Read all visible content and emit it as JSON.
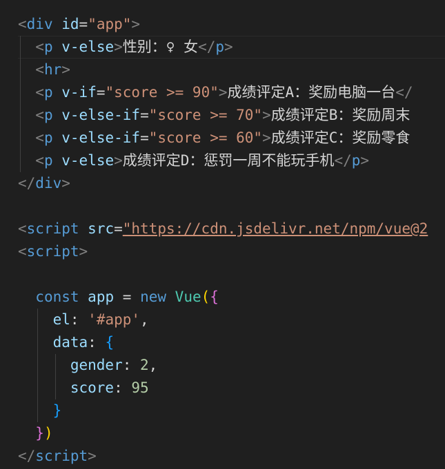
{
  "colors": {
    "background": "#1f1f1f",
    "tag_bracket": "#808080",
    "tag_name": "#569cd6",
    "attribute": "#9cdcfe",
    "string": "#ce9178",
    "text": "#d4d4d4",
    "keyword": "#569cd6",
    "class_name": "#4ec9b0",
    "number": "#b5cea8",
    "bracket_level1": "#ffd700",
    "bracket_level2": "#da70d6",
    "bracket_level3": "#179fff"
  },
  "code": {
    "div_open": {
      "tag": "div",
      "attr": "id",
      "value": "\"app\""
    },
    "p_gender": {
      "tag": "p",
      "attr": "v-else",
      "text": "性别：♀ 女"
    },
    "hr": {
      "tag": "hr"
    },
    "p_a": {
      "tag": "p",
      "attr": "v-if",
      "value": "\"score >= 90\"",
      "text": "成绩评定A：奖励电脑一台"
    },
    "p_b": {
      "tag": "p",
      "attr": "v-else-if",
      "value": "\"score >= 70\"",
      "text": "成绩评定B：奖励周末"
    },
    "p_c": {
      "tag": "p",
      "attr": "v-else-if",
      "value": "\"score >= 60\"",
      "text": "成绩评定C：奖励零食"
    },
    "p_d": {
      "tag": "p",
      "attr": "v-else",
      "text": "成绩评定D：惩罚一周不能玩手机"
    },
    "div_close": {
      "tag": "div"
    },
    "script_src": {
      "tag": "script",
      "attr": "src",
      "value": "\"https://cdn.jsdelivr.net/npm/vue@2"
    },
    "script_open": {
      "tag": "script"
    },
    "js_const": {
      "kw_const": "const",
      "var": "app",
      "op": "=",
      "kw_new": "new",
      "cls": "Vue"
    },
    "js_el": {
      "key": "el",
      "value": "'#app'"
    },
    "js_data": {
      "key": "data"
    },
    "js_gender": {
      "key": "gender",
      "value": "2"
    },
    "js_score": {
      "key": "score",
      "value": "95"
    },
    "script_close": {
      "tag": "script"
    }
  }
}
